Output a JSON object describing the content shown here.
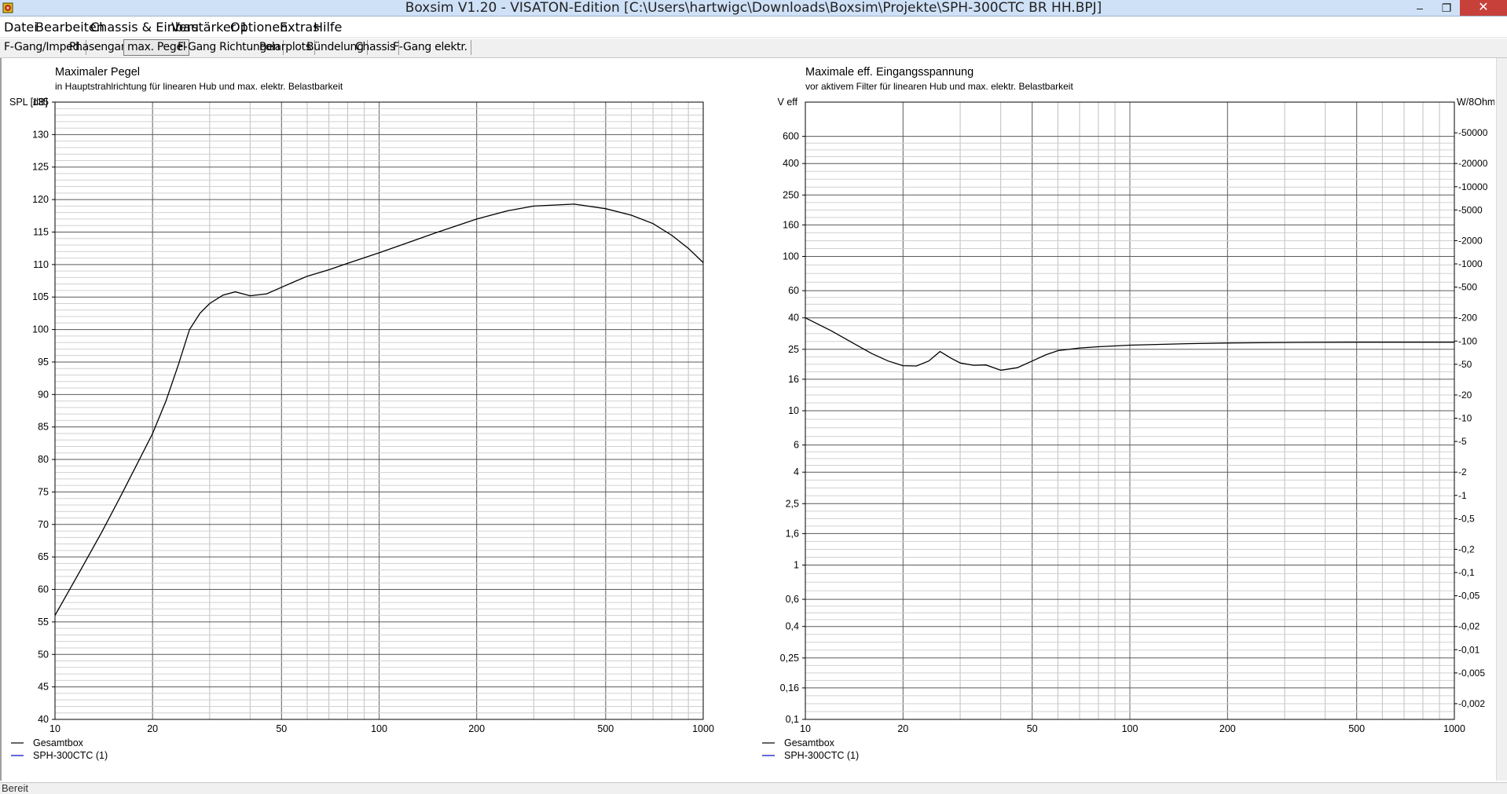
{
  "window": {
    "title": "Boxsim V1.20 - VISATON-Edition [C:\\Users\\hartwigc\\Downloads\\Boxsim\\Projekte\\SPH-300CTC BR HH.BPJ]",
    "app_icon": "boxsim-app-icon",
    "controls": {
      "minimize": "minimize-icon",
      "maximize": "maximize-icon",
      "close": "close-icon"
    }
  },
  "menu": [
    "Datei",
    "Bearbeiten",
    "Chassis & Einbau",
    "Verstärker 1",
    "Optionen",
    "Extras",
    "Hilfe"
  ],
  "tabs": [
    {
      "label": "F-Gang/Imped.",
      "active": false
    },
    {
      "label": "Phasengang",
      "active": false
    },
    {
      "label": "max. Pegel",
      "active": true
    },
    {
      "label": "F-Gang Richtungen",
      "active": false
    },
    {
      "label": "Polarplots",
      "active": false
    },
    {
      "label": "Bündelung",
      "active": false
    },
    {
      "label": "Chassis",
      "active": false
    },
    {
      "label": "F-Gang elektr.",
      "active": false
    }
  ],
  "status": {
    "text": "Bereit"
  },
  "chart_data": [
    {
      "type": "line",
      "title": "Maximaler Pegel",
      "subtitle": "in Hauptstrahlrichtung für linearen Hub und max. elektr. Belastbarkeit",
      "ylabel": "SPL [dB]",
      "xscale": "log",
      "xlim": [
        10,
        1000
      ],
      "ylim": [
        40,
        135
      ],
      "xticks": [
        10,
        20,
        50,
        100,
        200,
        500,
        1000
      ],
      "yticks": [
        135,
        130,
        125,
        120,
        115,
        110,
        105,
        100,
        95,
        90,
        85,
        80,
        75,
        70,
        65,
        60,
        55,
        50,
        45,
        40
      ],
      "grid": true,
      "legend_position": "bottom-left",
      "legend": [
        {
          "label": "Gesamtbox",
          "color": "#000000"
        },
        {
          "label": "SPH-300CTC (1)",
          "color": "#0000cc"
        }
      ],
      "series": [
        {
          "name": "Gesamtbox",
          "color": "#000000",
          "x": [
            10,
            12,
            14,
            16,
            18,
            20,
            22,
            24,
            26,
            28,
            30,
            33,
            36,
            40,
            45,
            50,
            55,
            60,
            70,
            80,
            100,
            120,
            150,
            200,
            250,
            300,
            400,
            500,
            600,
            700,
            800,
            900,
            1000
          ],
          "y": [
            56,
            63,
            69,
            74.5,
            79.5,
            84,
            89,
            94.5,
            100,
            102.5,
            104,
            105.3,
            105.8,
            105.2,
            105.5,
            106.5,
            107.4,
            108.2,
            109.2,
            110.2,
            111.8,
            113.2,
            114.9,
            117,
            118.3,
            119,
            119.3,
            118.6,
            117.6,
            116.3,
            114.5,
            112.5,
            110.3
          ]
        }
      ]
    },
    {
      "type": "line",
      "title": "Maximale eff. Eingangsspannung",
      "subtitle": "vor aktivem Filter für linearen Hub und max. elektr. Belastbarkeit",
      "ylabel": "V eff",
      "y2label": "W/8Ohm",
      "xscale": "log",
      "yscale": "log",
      "xlim": [
        10,
        1000
      ],
      "ylim": [
        0.1,
        1000
      ],
      "xticks": [
        10,
        20,
        50,
        100,
        200,
        500,
        1000
      ],
      "yticks": [
        "600",
        "400",
        "250",
        "160",
        "100",
        "60",
        "40",
        "25",
        "16",
        "10",
        "6",
        "4",
        "2,5",
        "1,6",
        "1",
        "0,6",
        "0,4",
        "0,25",
        "0,16",
        "0,1"
      ],
      "y2ticks": [
        "50000",
        "20000",
        "10000",
        "5000",
        "2000",
        "1000",
        "500",
        "200",
        "100",
        "50",
        "20",
        "10",
        "5",
        "2",
        "1",
        "0,5",
        "0,2",
        "0,1",
        "0,05",
        "0,02",
        "0,01",
        "0,005",
        "0,002"
      ],
      "grid": true,
      "legend_position": "bottom-left",
      "legend": [
        {
          "label": "Gesamtbox",
          "color": "#000000"
        },
        {
          "label": "SPH-300CTC (1)",
          "color": "#0000cc"
        }
      ],
      "series": [
        {
          "name": "Gesamtbox",
          "color": "#000000",
          "x": [
            10,
            12,
            14,
            16,
            18,
            20,
            22,
            24,
            26,
            28,
            30,
            33,
            36,
            40,
            45,
            50,
            55,
            60,
            70,
            80,
            100,
            150,
            200,
            300,
            500,
            1000
          ],
          "y": [
            40,
            33,
            27.5,
            23.5,
            21,
            19.6,
            19.5,
            21,
            24.2,
            22,
            20.4,
            19.7,
            19.8,
            18.3,
            19,
            21,
            23,
            24.5,
            25.5,
            26,
            26.6,
            27.2,
            27.5,
            27.7,
            27.8,
            27.8
          ]
        }
      ]
    }
  ]
}
